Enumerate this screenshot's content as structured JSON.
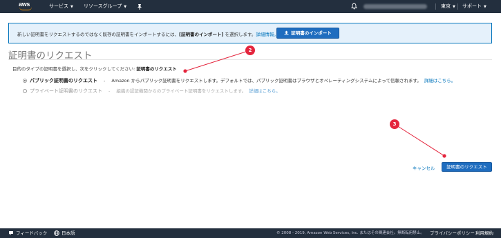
{
  "nav": {
    "logo_text": "aws",
    "services_label": "サービス",
    "resource_groups_label": "リソースグループ",
    "region_label": "東京",
    "support_label": "サポート"
  },
  "banner": {
    "text_prefix": "新しい証明書をリクエストするのではなく既存の証明書をインポートするには、",
    "text_bold": "[証明書のインポート]",
    "text_suffix": " を選択します。",
    "details_link": "詳細情報。",
    "import_button_label": "証明書のインポート"
  },
  "page": {
    "title": "証明書のリクエスト",
    "instruction_prefix": "目的のタイプの証明書を選択し、次をクリックしてください: ",
    "instruction_bold": "証明書のリクエスト"
  },
  "options": [
    {
      "label": "パブリック証明書のリクエスト",
      "description": "Amazon からパブリック証明書をリクエストします。デフォルトでは、パブリック証明書はブラウザとオペレーティングシステムによって信頼されます。",
      "link": "詳細はこちら。",
      "selected": true
    },
    {
      "label": "プライベート証明書のリクエスト",
      "description": "組織の認証機関からのプライベート証明書をリクエストします。",
      "link": "詳細はこちら。",
      "selected": false
    }
  ],
  "actions": {
    "cancel_label": "キャンセル",
    "request_label": "証明書のリクエスト"
  },
  "annotations": {
    "badge_2": "2",
    "badge_3": "3",
    "color": "#e4253d"
  },
  "footer": {
    "feedback_label": "フィードバック",
    "language_label": "日本語",
    "copyright": "© 2008 - 2019, Amazon Web Services, Inc. またはその関連会社。無断転用禁止。",
    "privacy_label": "プライバシーポリシー",
    "terms_label": "利用規約"
  },
  "colors": {
    "nav_bg": "#232f3e",
    "accent": "#ff9900",
    "primary_button": "#1f6dbf",
    "link": "#0073bb",
    "banner_bg": "#e5f1fb"
  }
}
